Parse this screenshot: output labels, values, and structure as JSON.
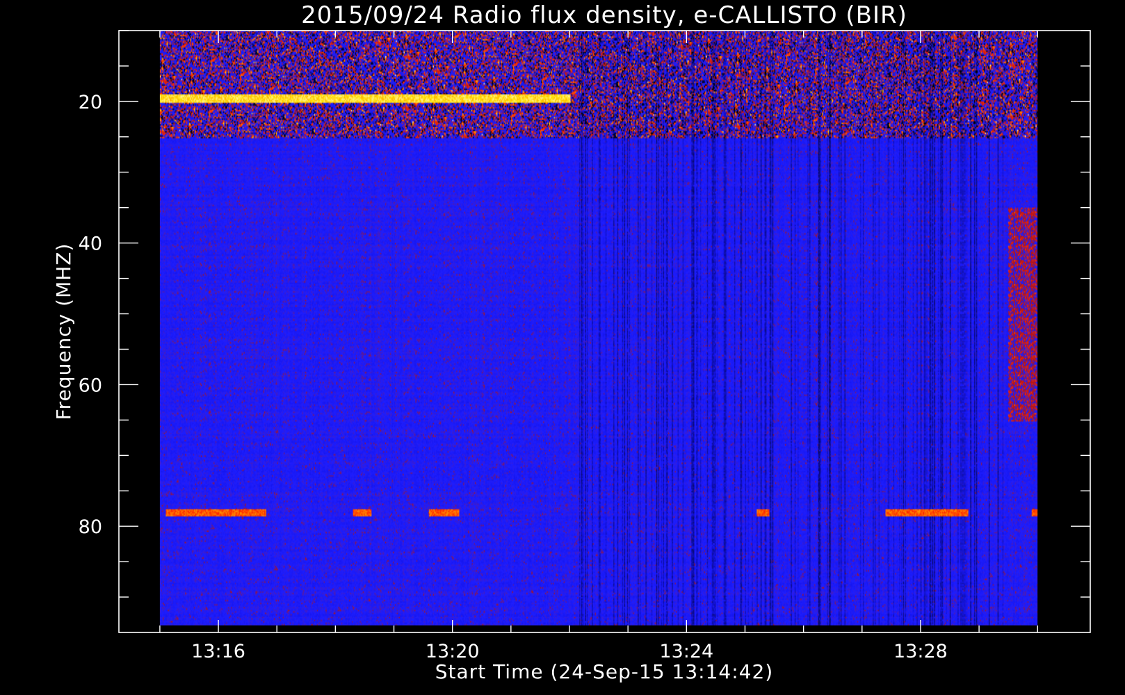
{
  "chart_data": {
    "type": "heatmap",
    "title": "2015/09/24  Radio flux density, e-CALLISTO (BIR)",
    "xlabel": "Start Time (24-Sep-15 13:14:42)",
    "ylabel": "Frequency (MHZ)",
    "x_ticks": [
      "13:16",
      "13:20",
      "13:24",
      "13:28"
    ],
    "x_tick_minutes": [
      16,
      20,
      24,
      28
    ],
    "y_ticks": [
      "20",
      "40",
      "60",
      "80"
    ],
    "y_tick_values": [
      20,
      40,
      60,
      80
    ],
    "xlim_minutes": [
      14.3,
      30.9
    ],
    "ylim": [
      10,
      95
    ],
    "y_inverted": true,
    "data_time_range_minutes": [
      15.0,
      30.0
    ],
    "data_freq_range_mhz": [
      10,
      94
    ],
    "grid": false,
    "colormap": [
      "#000000",
      "#1010ff",
      "#c01010",
      "#ff2a00",
      "#ffe000",
      "#ffffff"
    ],
    "background_level_color": "#1a1aee",
    "features": [
      {
        "kind": "rfi_band",
        "freq_mhz": [
          10,
          25
        ],
        "time_minutes": [
          15.0,
          30.0
        ],
        "intensity": "high"
      },
      {
        "kind": "bright_line",
        "freq_mhz": 19.5,
        "time_minutes": [
          15.0,
          22.0
        ],
        "intensity": "very_high"
      },
      {
        "kind": "bright_line",
        "freq_mhz": 78,
        "time_minutes": [
          15.1,
          16.8
        ],
        "intensity": "high"
      },
      {
        "kind": "bright_line",
        "freq_mhz": 78,
        "time_minutes": [
          18.3,
          18.6
        ],
        "intensity": "high"
      },
      {
        "kind": "bright_line",
        "freq_mhz": 78,
        "time_minutes": [
          19.6,
          20.1
        ],
        "intensity": "high"
      },
      {
        "kind": "bright_line",
        "freq_mhz": 78,
        "time_minutes": [
          25.2,
          25.4
        ],
        "intensity": "high"
      },
      {
        "kind": "bright_line",
        "freq_mhz": 78,
        "time_minutes": [
          27.4,
          28.8
        ],
        "intensity": "high"
      },
      {
        "kind": "bright_line",
        "freq_mhz": 78,
        "time_minutes": [
          29.9,
          30.0
        ],
        "intensity": "high"
      },
      {
        "kind": "burst",
        "freq_mhz": [
          35,
          65
        ],
        "time_minutes": [
          29.5,
          30.0
        ],
        "intensity": "medium"
      },
      {
        "kind": "dark_striations",
        "freq_mhz": [
          10,
          94
        ],
        "time_minutes": [
          22.0,
          29.5
        ],
        "intensity": "low"
      }
    ]
  }
}
